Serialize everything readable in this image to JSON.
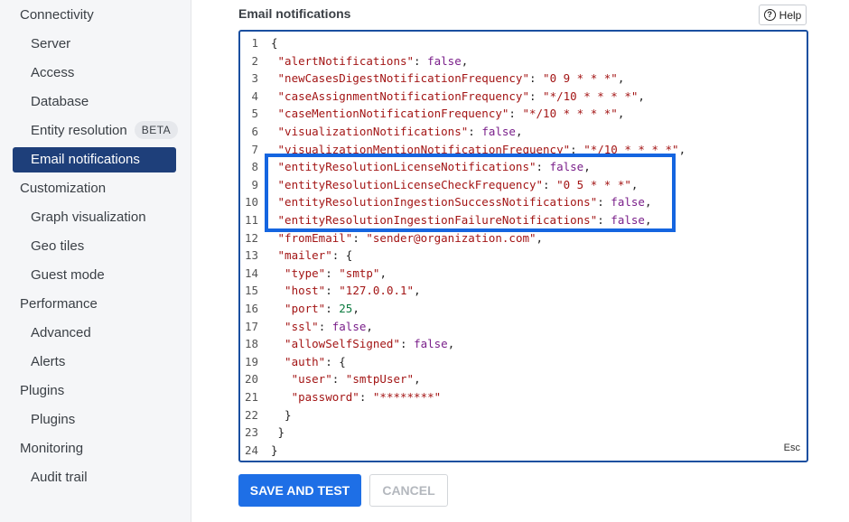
{
  "sidebar": {
    "items": [
      {
        "label": "Connectivity",
        "kind": "section"
      },
      {
        "label": "Server",
        "kind": "child"
      },
      {
        "label": "Access",
        "kind": "child"
      },
      {
        "label": "Database",
        "kind": "child"
      },
      {
        "label": "Entity resolution",
        "kind": "child",
        "badge": "BETA"
      },
      {
        "label": "Email notifications",
        "kind": "child",
        "active": true
      },
      {
        "label": "Customization",
        "kind": "section"
      },
      {
        "label": "Graph visualization",
        "kind": "child"
      },
      {
        "label": "Geo tiles",
        "kind": "child"
      },
      {
        "label": "Guest mode",
        "kind": "child"
      },
      {
        "label": "Performance",
        "kind": "section"
      },
      {
        "label": "Advanced",
        "kind": "child"
      },
      {
        "label": "Alerts",
        "kind": "child"
      },
      {
        "label": "Plugins",
        "kind": "section"
      },
      {
        "label": "Plugins",
        "kind": "child"
      },
      {
        "label": "Monitoring",
        "kind": "section"
      },
      {
        "label": "Audit trail",
        "kind": "child"
      }
    ]
  },
  "main": {
    "title": "Email notifications",
    "help_label": "Help",
    "help_icon": "question-circle-icon",
    "esc_label": "Esc",
    "save_label": "SAVE AND TEST",
    "cancel_label": "CANCEL"
  },
  "editor": {
    "lines": [
      {
        "n": "1",
        "parts": [
          [
            "p",
            "{"
          ]
        ]
      },
      {
        "n": "2",
        "parts": [
          [
            "k",
            " \"alertNotifications\""
          ],
          [
            "p",
            ": "
          ],
          [
            "b",
            "false"
          ],
          [
            "p",
            ","
          ]
        ]
      },
      {
        "n": "3",
        "parts": [
          [
            "k",
            " \"newCasesDigestNotificationFrequency\""
          ],
          [
            "p",
            ": "
          ],
          [
            "s",
            "\"0 9 * * *\""
          ],
          [
            "p",
            ","
          ]
        ]
      },
      {
        "n": "4",
        "parts": [
          [
            "k",
            " \"caseAssignmentNotificationFrequency\""
          ],
          [
            "p",
            ": "
          ],
          [
            "s",
            "\"*/10 * * * *\""
          ],
          [
            "p",
            ","
          ]
        ]
      },
      {
        "n": "5",
        "parts": [
          [
            "k",
            " \"caseMentionNotificationFrequency\""
          ],
          [
            "p",
            ": "
          ],
          [
            "s",
            "\"*/10 * * * *\""
          ],
          [
            "p",
            ","
          ]
        ]
      },
      {
        "n": "6",
        "parts": [
          [
            "k",
            " \"visualizationNotifications\""
          ],
          [
            "p",
            ": "
          ],
          [
            "b",
            "false"
          ],
          [
            "p",
            ","
          ]
        ]
      },
      {
        "n": "7",
        "parts": [
          [
            "k",
            " \"visualizationMentionNotificationFrequency\""
          ],
          [
            "p",
            ": "
          ],
          [
            "s",
            "\"*/10 * * * *\""
          ],
          [
            "p",
            ","
          ]
        ]
      },
      {
        "n": "8",
        "parts": [
          [
            "k",
            " \"entityResolutionLicenseNotifications\""
          ],
          [
            "p",
            ": "
          ],
          [
            "b",
            "false"
          ],
          [
            "p",
            ","
          ]
        ]
      },
      {
        "n": "9",
        "parts": [
          [
            "k",
            " \"entityResolutionLicenseCheckFrequency\""
          ],
          [
            "p",
            ": "
          ],
          [
            "s",
            "\"0 5 * * *\""
          ],
          [
            "p",
            ","
          ]
        ]
      },
      {
        "n": "10",
        "parts": [
          [
            "k",
            " \"entityResolutionIngestionSuccessNotifications\""
          ],
          [
            "p",
            ": "
          ],
          [
            "b",
            "false"
          ],
          [
            "p",
            ","
          ]
        ]
      },
      {
        "n": "11",
        "parts": [
          [
            "k",
            " \"entityResolutionIngestionFailureNotifications\""
          ],
          [
            "p",
            ": "
          ],
          [
            "b",
            "false"
          ],
          [
            "p",
            ","
          ]
        ]
      },
      {
        "n": "12",
        "parts": [
          [
            "k",
            " \"fromEmail\""
          ],
          [
            "p",
            ": "
          ],
          [
            "s",
            "\"sender@organization.com\""
          ],
          [
            "p",
            ","
          ]
        ]
      },
      {
        "n": "13",
        "parts": [
          [
            "k",
            " \"mailer\""
          ],
          [
            "p",
            ": {"
          ]
        ]
      },
      {
        "n": "14",
        "parts": [
          [
            "k",
            "  \"type\""
          ],
          [
            "p",
            ": "
          ],
          [
            "s",
            "\"smtp\""
          ],
          [
            "p",
            ","
          ]
        ]
      },
      {
        "n": "15",
        "parts": [
          [
            "k",
            "  \"host\""
          ],
          [
            "p",
            ": "
          ],
          [
            "s",
            "\"127.0.0.1\""
          ],
          [
            "p",
            ","
          ]
        ]
      },
      {
        "n": "16",
        "parts": [
          [
            "k",
            "  \"port\""
          ],
          [
            "p",
            ": "
          ],
          [
            "n",
            "25"
          ],
          [
            "p",
            ","
          ]
        ]
      },
      {
        "n": "17",
        "parts": [
          [
            "k",
            "  \"ssl\""
          ],
          [
            "p",
            ": "
          ],
          [
            "b",
            "false"
          ],
          [
            "p",
            ","
          ]
        ]
      },
      {
        "n": "18",
        "parts": [
          [
            "k",
            "  \"allowSelfSigned\""
          ],
          [
            "p",
            ": "
          ],
          [
            "b",
            "false"
          ],
          [
            "p",
            ","
          ]
        ]
      },
      {
        "n": "19",
        "parts": [
          [
            "k",
            "  \"auth\""
          ],
          [
            "p",
            ": {"
          ]
        ]
      },
      {
        "n": "20",
        "parts": [
          [
            "k",
            "   \"user\""
          ],
          [
            "p",
            ": "
          ],
          [
            "s",
            "\"smtpUser\""
          ],
          [
            "p",
            ","
          ]
        ]
      },
      {
        "n": "21",
        "parts": [
          [
            "k",
            "   \"password\""
          ],
          [
            "p",
            ": "
          ],
          [
            "s",
            "\"********\""
          ]
        ]
      },
      {
        "n": "22",
        "parts": [
          [
            "p",
            "  }"
          ]
        ]
      },
      {
        "n": "23",
        "parts": [
          [
            "p",
            " }"
          ]
        ]
      },
      {
        "n": "24",
        "parts": [
          [
            "p",
            "}"
          ]
        ]
      }
    ]
  },
  "colors": {
    "sidebar_active_bg": "#1e3f7a",
    "editor_border": "#1a4fa0",
    "highlight_border": "#1565e0",
    "primary_button": "#1e6fe6",
    "json_key": "#a31515",
    "json_boolean": "#7a1f8a",
    "json_number": "#0a7a3e"
  }
}
